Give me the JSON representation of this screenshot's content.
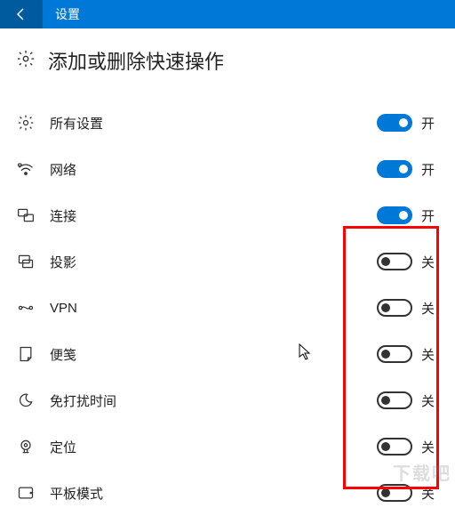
{
  "header": {
    "title": "设置"
  },
  "page": {
    "title": "添加或删除快速操作"
  },
  "items": [
    {
      "icon": "gear",
      "label": "所有设置",
      "state": "on",
      "stateLabel": "开"
    },
    {
      "icon": "wifi",
      "label": "网络",
      "state": "on",
      "stateLabel": "开"
    },
    {
      "icon": "connect",
      "label": "连接",
      "state": "on",
      "stateLabel": "开"
    },
    {
      "icon": "project",
      "label": "投影",
      "state": "off",
      "stateLabel": "关"
    },
    {
      "icon": "vpn",
      "label": "VPN",
      "state": "off",
      "stateLabel": "关"
    },
    {
      "icon": "note",
      "label": "便笺",
      "state": "off",
      "stateLabel": "关"
    },
    {
      "icon": "moon",
      "label": "免打扰时间",
      "state": "off",
      "stateLabel": "关"
    },
    {
      "icon": "location",
      "label": "定位",
      "state": "off",
      "stateLabel": "关"
    },
    {
      "icon": "tablet",
      "label": "平板模式",
      "state": "off",
      "stateLabel": "关"
    }
  ],
  "watermark": "下载吧"
}
